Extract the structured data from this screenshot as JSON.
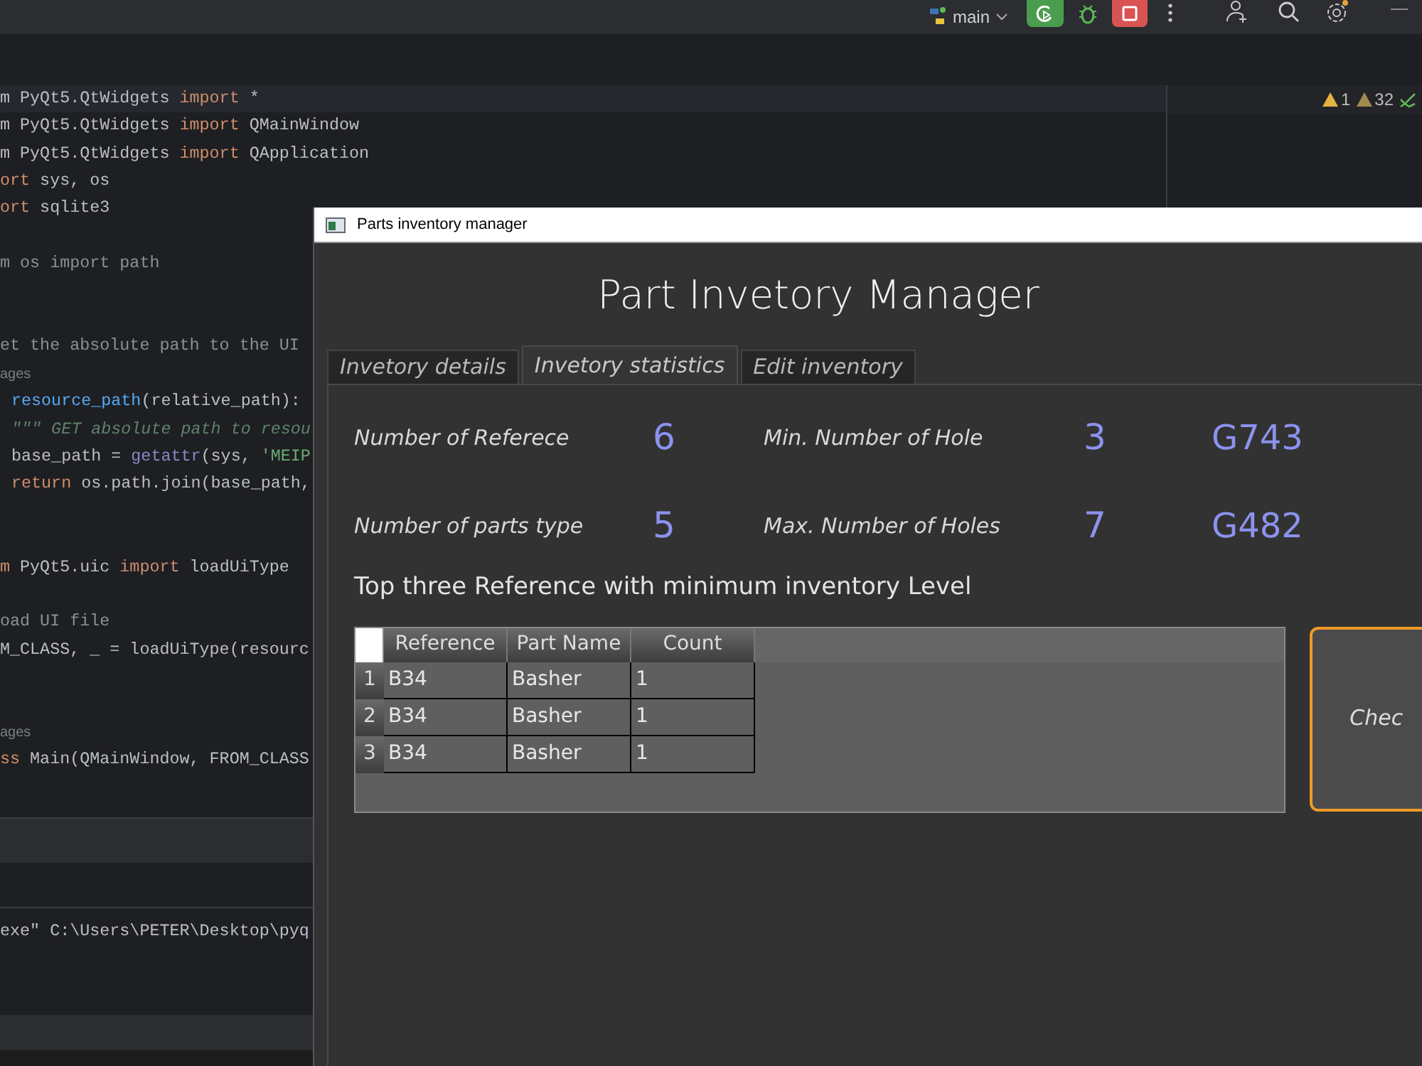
{
  "ide": {
    "toolbar": {
      "branch": "main",
      "inspections": [
        {
          "kind": "error",
          "count": "1"
        },
        {
          "kind": "warning",
          "count": "32"
        }
      ]
    },
    "code_lines": [
      {
        "kind": "top",
        "highlighted": true,
        "parts": [
          {
            "kind": "plain",
            "t": "m PyQt5.QtWidgets "
          },
          {
            "kind": "keyword",
            "t": "import"
          },
          {
            "kind": "plain",
            "t": " *"
          }
        ]
      },
      {
        "kind": "top",
        "highlighted": false,
        "parts": [
          {
            "kind": "plain",
            "t": "m PyQt5.QtWidgets "
          },
          {
            "kind": "keyword",
            "t": "import"
          },
          {
            "kind": "plain",
            "t": " QMainWindow"
          }
        ]
      },
      {
        "kind": "top",
        "highlighted": false,
        "parts": [
          {
            "kind": "plain",
            "t": "m PyQt5.QtWidgets "
          },
          {
            "kind": "keyword",
            "t": "import"
          },
          {
            "kind": "plain",
            "t": " QApplication"
          }
        ]
      },
      {
        "kind": "top",
        "highlighted": false,
        "parts": [
          {
            "kind": "keyword",
            "t": "ort"
          },
          {
            "kind": "plain",
            "t": " sys, os"
          }
        ]
      },
      {
        "kind": "top",
        "highlighted": false,
        "parts": [
          {
            "kind": "keyword",
            "t": "ort"
          },
          {
            "kind": "plain",
            "t": " sqlite3"
          }
        ]
      },
      {
        "kind": "blank"
      },
      {
        "kind": "top",
        "highlighted": false,
        "parts": [
          {
            "kind": "comment",
            "t": "m os import path"
          }
        ]
      },
      {
        "kind": "blank"
      },
      {
        "kind": "blank"
      },
      {
        "kind": "top",
        "highlighted": false,
        "parts": [
          {
            "kind": "comment",
            "t": "et the absolute path to the UI"
          }
        ]
      },
      {
        "kind": "hint",
        "text": "ages"
      },
      {
        "kind": "body",
        "highlighted": false,
        "parts": [
          {
            "kind": "function",
            "t": "resource_path"
          },
          {
            "kind": "plain",
            "t": "(relative_path):"
          }
        ]
      },
      {
        "kind": "body",
        "highlighted": false,
        "parts": [
          {
            "kind": "docstring",
            "t": "\"\"\" GET absolute path to resou"
          }
        ]
      },
      {
        "kind": "body",
        "highlighted": false,
        "parts": [
          {
            "kind": "plain",
            "t": "base_path = "
          },
          {
            "kind": "builtin",
            "t": "getattr"
          },
          {
            "kind": "plain",
            "t": "(sys, "
          },
          {
            "kind": "string",
            "t": "'MEIP"
          }
        ]
      },
      {
        "kind": "body",
        "highlighted": false,
        "parts": [
          {
            "kind": "keyword",
            "t": "return"
          },
          {
            "kind": "plain",
            "t": " os.path.join(base_path,"
          }
        ]
      },
      {
        "kind": "blank"
      },
      {
        "kind": "blank"
      },
      {
        "kind": "top",
        "highlighted": false,
        "parts": [
          {
            "kind": "keyword",
            "t": "m"
          },
          {
            "kind": "plain",
            "t": " PyQt5.uic "
          },
          {
            "kind": "keyword",
            "t": "import"
          },
          {
            "kind": "plain",
            "t": " loadUiType"
          }
        ]
      },
      {
        "kind": "blank"
      },
      {
        "kind": "top",
        "highlighted": false,
        "parts": [
          {
            "kind": "comment",
            "t": "oad UI file"
          }
        ]
      },
      {
        "kind": "top",
        "highlighted": false,
        "parts": [
          {
            "kind": "plain",
            "t": "M_CLASS, _ = loadUiType(resourc"
          }
        ]
      },
      {
        "kind": "blank"
      },
      {
        "kind": "blank"
      },
      {
        "kind": "hint",
        "text": "ages"
      },
      {
        "kind": "top",
        "highlighted": false,
        "parts": [
          {
            "kind": "keyword",
            "t": "ss"
          },
          {
            "kind": "plain",
            "t": " Main(QMainWindow, FROM_CLASS"
          }
        ]
      }
    ],
    "console_line": "exe\" C:\\Users\\PETER\\Desktop\\pyq"
  },
  "app": {
    "window_title": "Parts inventory manager",
    "heading": "Part Invetory Manager",
    "tabs": [
      {
        "label": "Invetory details",
        "selected": false
      },
      {
        "label": "Invetory statistics",
        "selected": true
      },
      {
        "label": "Edit inventory",
        "selected": false
      }
    ],
    "stats": [
      {
        "label": "Number of Referece",
        "value": "6",
        "label_2": "Min. Number of Hole",
        "value_2": "3",
        "reference": "G743"
      },
      {
        "label": "Number of parts type",
        "value": "5",
        "label_2": "Max. Number of Holes",
        "value_2": "7",
        "reference": "G482"
      }
    ],
    "table_title": "Top three Reference with minimum inventory Level",
    "table": {
      "columns": [
        "Reference",
        "Part Name",
        "Count"
      ],
      "rows": [
        {
          "header": "1",
          "cells": [
            "B34",
            "Basher",
            "1"
          ]
        },
        {
          "header": "2",
          "cells": [
            "B34",
            "Basher",
            "1"
          ]
        },
        {
          "header": "3",
          "cells": [
            "B34",
            "Basher",
            "1"
          ]
        }
      ]
    },
    "button": "Chec"
  }
}
